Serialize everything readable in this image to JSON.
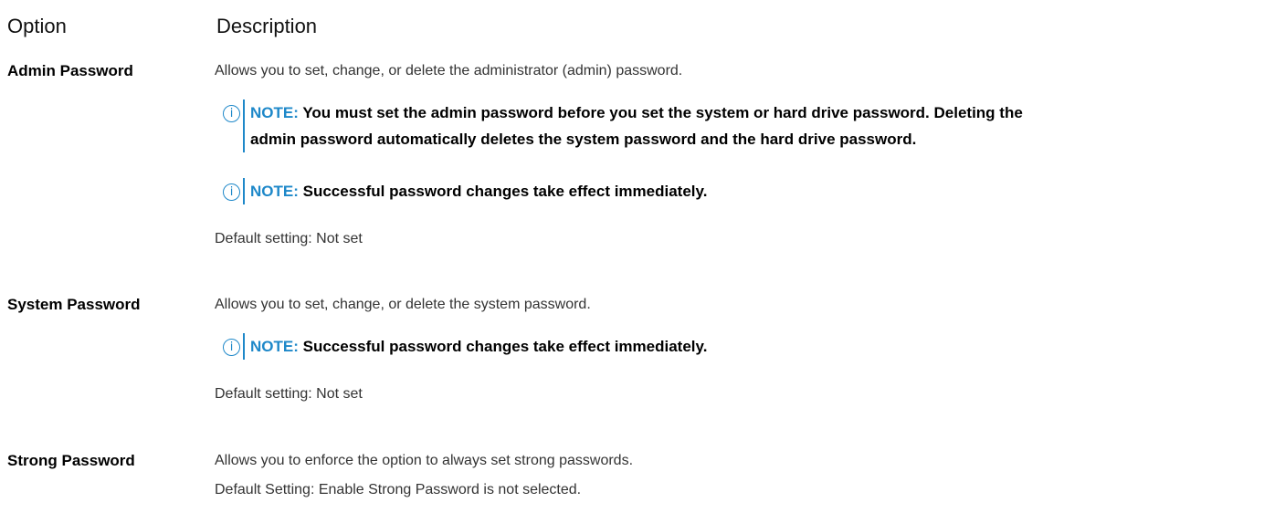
{
  "header": {
    "option": "Option",
    "description": "Description"
  },
  "options": [
    {
      "label": "Admin Password",
      "description": "Allows you to set, change, or delete the administrator (admin) password.",
      "notes": [
        {
          "keyword": "NOTE:",
          "lines": [
            "You must set the admin password before you set the system or hard drive password. Deleting the",
            "admin password automatically deletes the system password and the hard drive password."
          ]
        },
        {
          "keyword": "NOTE:",
          "lines": [
            "Successful password changes take effect immediately."
          ]
        }
      ],
      "default": "Default setting: Not set"
    },
    {
      "label": "System Password",
      "description": "Allows you to set, change, or delete the system password.",
      "notes": [
        {
          "keyword": "NOTE:",
          "lines": [
            "Successful password changes take effect immediately."
          ]
        }
      ],
      "default": "Default setting: Not set"
    },
    {
      "label": "Strong Password",
      "description": "Allows you to enforce the option to always set strong passwords.",
      "default": "Default Setting: Enable Strong Password is not selected."
    }
  ],
  "icons": {
    "note_icon": "info-circle-icon",
    "note_glyph": "i"
  },
  "colors": {
    "accent": "#1e88c9",
    "text": "#333333"
  }
}
